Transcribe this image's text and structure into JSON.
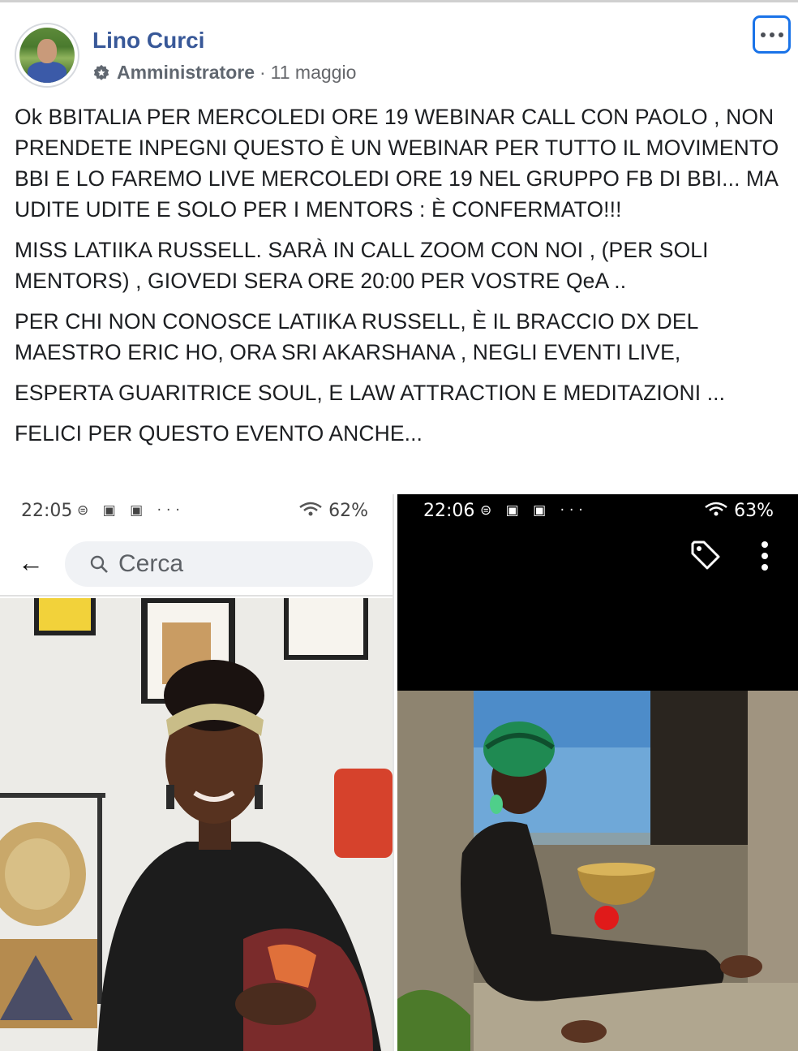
{
  "post": {
    "author_name": "Lino Curci",
    "author_role": "Amministratore",
    "date": "11 maggio",
    "paragraphs": [
      "Ok BBITALIA PER MERCOLEDI ORE 19 WEBINAR CALL CON PAOLO , NON PRENDETE INPEGNI QUESTO È UN WEBINAR PER TUTTO IL MOVIMENTO BBI E LO FAREMO LIVE MERCOLEDI ORE 19 NEL GRUPPO FB DI BBI... MA UDITE UDITE E SOLO PER I MENTORS : È CONFERMATO!!!",
      "MISS LATIIKA RUSSELL. SARÀ IN CALL ZOOM CON NOI , (PER SOLI MENTORS) , GIOVEDI SERA ORE 20:00 PER VOSTRE QeA ..",
      "PER CHI NON CONOSCE LATIIKA RUSSELL, È IL BRACCIO DX DEL MAESTRO ERIC HO, ORA SRI AKARSHANA , NEGLI EVENTI LIVE,",
      "ESPERTA GUARITRICE SOUL, E LAW ATTRACTION E MEDITAZIONI ...",
      "FELICI PER QUESTO EVENTO ANCHE..."
    ],
    "more_icon": "ellipsis-icon",
    "role_icon": "admin-badge-icon"
  },
  "screenshot_left": {
    "time": "22:05",
    "status_icons": "⊜ ▣ ▣ ···",
    "battery": "62%",
    "search_placeholder": "Cerca"
  },
  "screenshot_right": {
    "time": "22:06",
    "status_icons": "⊜ ▣ ▣ ···",
    "battery": "63%"
  },
  "colors": {
    "name_link": "#385898",
    "focus_ring": "#1a73e8",
    "text": "#1c1e21",
    "secondary": "#65676b"
  }
}
